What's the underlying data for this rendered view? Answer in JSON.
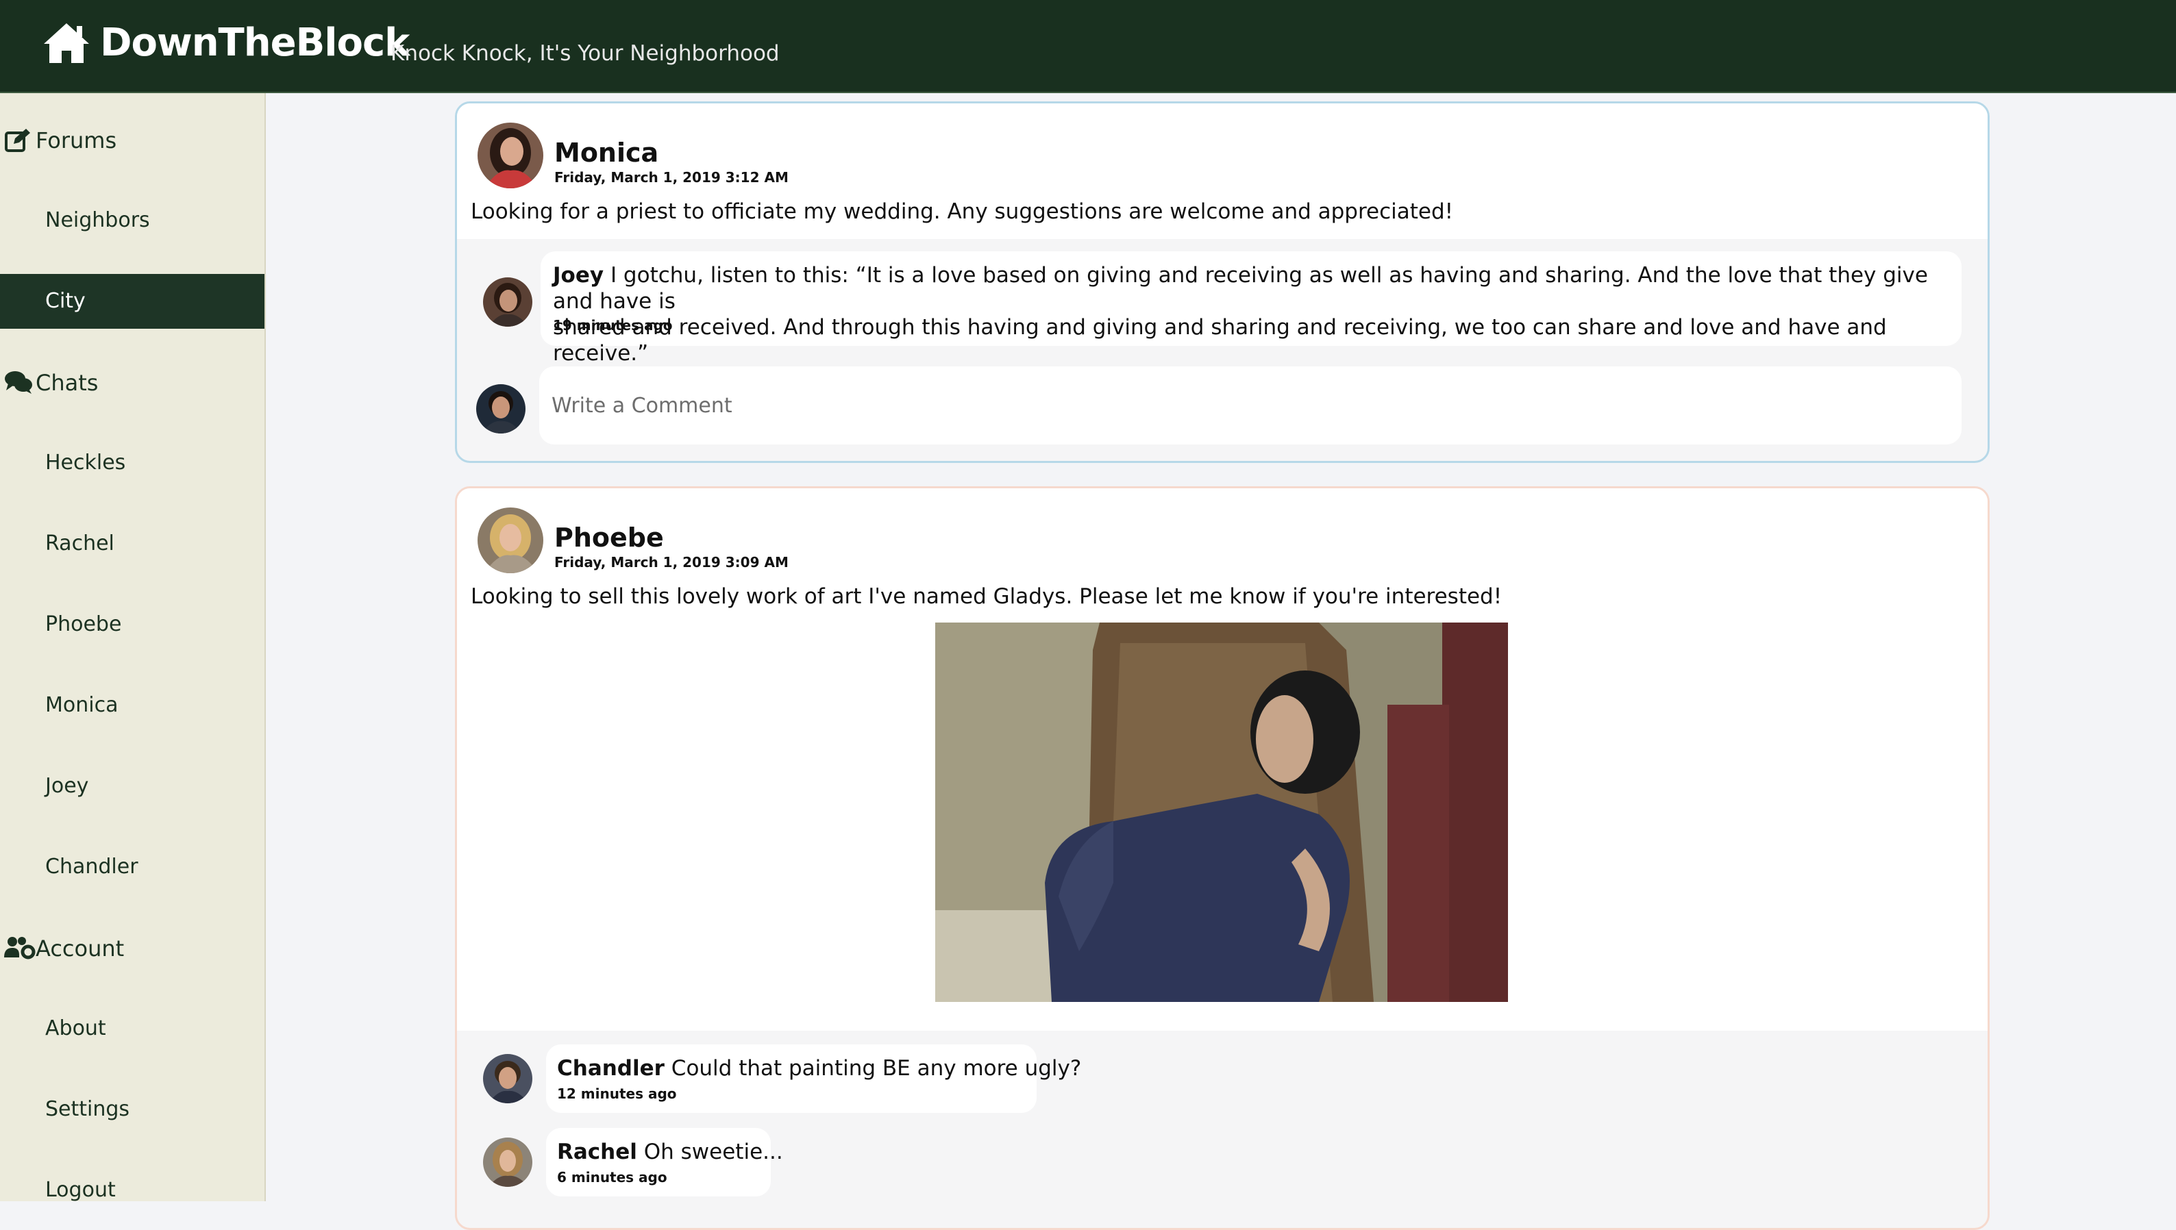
{
  "header": {
    "brand": "DownTheBlock",
    "tagline": "Knock Knock, It's Your Neighborhood",
    "home_icon": "home-icon",
    "background": "#19301f"
  },
  "sidebar": {
    "background": "#ecebdc",
    "active_color": "#1e3526",
    "items": [
      {
        "label": "Forums",
        "type": "section",
        "icon": "edit-icon"
      },
      {
        "label": "Neighbors",
        "type": "link"
      },
      {
        "label": "City",
        "type": "link",
        "active": true
      },
      {
        "label": "Chats",
        "type": "section",
        "icon": "chat-bubbles-icon"
      },
      {
        "label": "Heckles",
        "type": "link"
      },
      {
        "label": "Rachel",
        "type": "link"
      },
      {
        "label": "Phoebe",
        "type": "link"
      },
      {
        "label": "Monica",
        "type": "link"
      },
      {
        "label": "Joey",
        "type": "link"
      },
      {
        "label": "Chandler",
        "type": "link"
      },
      {
        "label": "Account",
        "type": "section",
        "icon": "users-cog-icon"
      },
      {
        "label": "About",
        "type": "link"
      },
      {
        "label": "Settings",
        "type": "link"
      },
      {
        "label": "Logout",
        "type": "link"
      }
    ]
  },
  "posts": [
    {
      "author": "Monica",
      "date": "Friday, March 1, 2019 3:12 AM",
      "text": "Looking for a priest to officiate my wedding. Any suggestions are welcome and appreciated!",
      "border_color": "#b6d8e8",
      "comments": [
        {
          "author": "Joey",
          "text_line1": "I gotchu, listen to this: “It is a love based on giving and receiving as well as having and sharing. And the love that they give and have is",
          "text_line2": "shared and received. And through this having and giving and sharing and receiving, we too can share and love and have and receive.”",
          "time": "19 minutes ago"
        }
      ],
      "comment_placeholder": "Write a Comment"
    },
    {
      "author": "Phoebe",
      "date": "Friday, March 1, 2019 3:09 AM",
      "text": "Looking to sell this lovely work of art I've named Gladys. Please let me know if you're interested!",
      "border_color": "#f6d9cd",
      "image": "gladys-artwork",
      "comments": [
        {
          "author": "Chandler",
          "text": "Could that painting BE any more ugly?",
          "time": "12 minutes ago"
        },
        {
          "author": "Rachel",
          "text": "Oh sweetie...",
          "time": "6 minutes ago"
        }
      ]
    }
  ]
}
